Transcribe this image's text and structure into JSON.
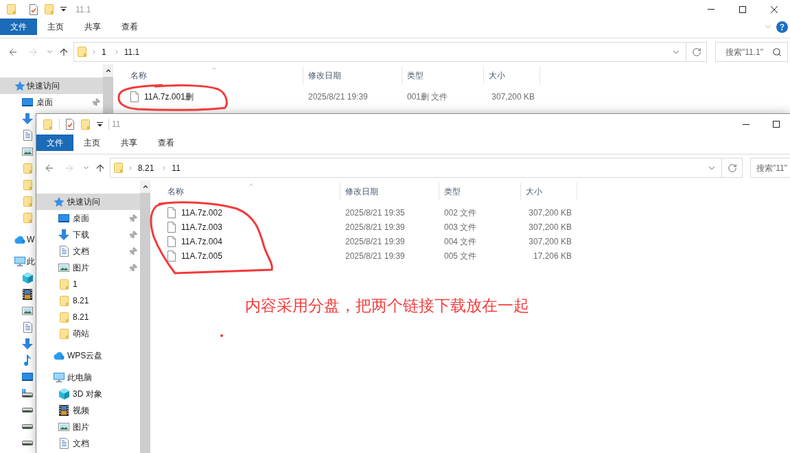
{
  "windows": [
    {
      "title": "11.1",
      "ribbon_tabs": [
        {
          "label": "文件",
          "selected": true
        },
        {
          "label": "主页",
          "selected": false
        },
        {
          "label": "共享",
          "selected": false
        },
        {
          "label": "查看",
          "selected": false
        }
      ],
      "navigation": {
        "back_disabled": false,
        "forward_disabled": true
      },
      "address_path": [
        "1",
        "11.1"
      ],
      "search": {
        "placeholder": "搜索\"11.1\""
      },
      "nav_tree": [
        {
          "label": "快速访问",
          "kind": "quickaccess",
          "selected": true,
          "children": [
            {
              "label": "桌面",
              "kind": "desktop",
              "selected": false,
              "pinned": true
            },
            {
              "kind": "downloads"
            },
            {
              "kind": "documents"
            },
            {
              "kind": "pictures"
            },
            {
              "kind": "folder"
            },
            {
              "kind": "folder"
            },
            {
              "kind": "folder"
            },
            {
              "kind": "folder"
            }
          ]
        },
        {
          "label": "W",
          "kind": "cloud",
          "selected": false
        },
        {
          "label": "此",
          "kind": "pc",
          "selected": false,
          "children": [
            {
              "kind": "objects"
            },
            {
              "kind": "video"
            },
            {
              "kind": "pictures"
            },
            {
              "kind": "documents"
            },
            {
              "kind": "downloads"
            },
            {
              "kind": "music"
            },
            {
              "kind": "desktop"
            },
            {
              "kind": "systemdrive"
            },
            {
              "kind": "drive"
            },
            {
              "kind": "drive"
            },
            {
              "kind": "drive"
            }
          ]
        }
      ],
      "columns": [
        {
          "label": "名称",
          "sorted": true
        },
        {
          "label": "修改日期",
          "sorted": false
        },
        {
          "label": "类型",
          "sorted": false
        },
        {
          "label": "大小",
          "sorted": false
        }
      ],
      "files": [
        {
          "name": "11A.7z.001删",
          "modified": "2025/8/21 19:39",
          "type": "001删 文件",
          "size": "307,200 KB"
        }
      ]
    },
    {
      "title": "11",
      "ribbon_tabs": [
        {
          "label": "文件",
          "selected": true
        },
        {
          "label": "主页",
          "selected": false
        },
        {
          "label": "共享",
          "selected": false
        },
        {
          "label": "查看",
          "selected": false
        }
      ],
      "navigation": {
        "back_disabled": false,
        "forward_disabled": true
      },
      "address_path": [
        "8.21",
        "11"
      ],
      "search": {
        "placeholder": "搜索\"11\""
      },
      "nav_tree": [
        {
          "label": "快速访问",
          "kind": "quickaccess",
          "selected": true,
          "children": [
            {
              "label": "桌面",
              "kind": "desktop",
              "selected": false,
              "pinned": true
            },
            {
              "label": "下载",
              "kind": "downloads",
              "selected": false,
              "pinned": true
            },
            {
              "label": "文档",
              "kind": "documents",
              "selected": false,
              "pinned": true
            },
            {
              "label": "图片",
              "kind": "pictures",
              "selected": false,
              "pinned": true
            },
            {
              "label": "1",
              "kind": "folder",
              "selected": false,
              "pinned": false
            },
            {
              "label": "8.21",
              "kind": "folder",
              "selected": false,
              "pinned": false
            },
            {
              "label": "8.21",
              "kind": "folder",
              "selected": false,
              "pinned": false
            },
            {
              "label": "萌站",
              "kind": "folder",
              "selected": false,
              "pinned": false
            }
          ]
        },
        {
          "label": "WPS云盘",
          "kind": "cloud",
          "selected": false
        },
        {
          "label": "此电脑",
          "kind": "pc",
          "selected": false,
          "children": [
            {
              "label": "3D 对象",
              "kind": "objects",
              "selected": false
            },
            {
              "label": "视频",
              "kind": "video",
              "selected": false
            },
            {
              "label": "图片",
              "kind": "pictures",
              "selected": false
            },
            {
              "label": "文档",
              "kind": "documents",
              "selected": false
            }
          ]
        }
      ],
      "columns": [
        {
          "label": "名称",
          "sorted": true
        },
        {
          "label": "修改日期",
          "sorted": false
        },
        {
          "label": "类型",
          "sorted": false
        },
        {
          "label": "大小",
          "sorted": false
        }
      ],
      "files": [
        {
          "name": "11A.7z.002",
          "modified": "2025/8/21 19:35",
          "type": "002 文件",
          "size": "307,200 KB"
        },
        {
          "name": "11A.7z.003",
          "modified": "2025/8/21 19:39",
          "type": "003 文件",
          "size": "307,200 KB"
        },
        {
          "name": "11A.7z.004",
          "modified": "2025/8/21 19:39",
          "type": "004 文件",
          "size": "307,200 KB"
        },
        {
          "name": "11A.7z.005",
          "modified": "2025/8/21 19:39",
          "type": "005 文件",
          "size": "17,206 KB"
        }
      ]
    }
  ],
  "annotation": {
    "note": "内容采用分盘，把两个链接下载放在一起"
  }
}
